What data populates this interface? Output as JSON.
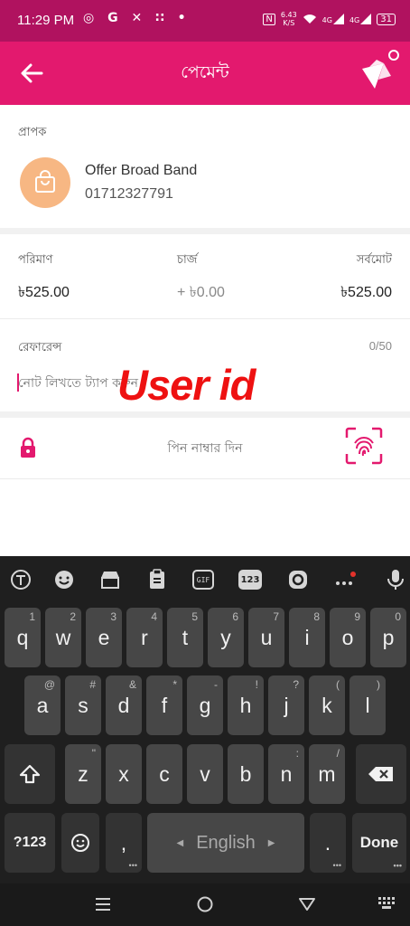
{
  "status_bar": {
    "time": "11:29 PM",
    "notif_icons": "◎ G ✕ ∷ •",
    "net_speed_value": "6.43",
    "net_speed_unit": "K/S",
    "signal1": "4G",
    "signal2": "4G",
    "battery": "31",
    "nfc": "N"
  },
  "app_bar": {
    "title": "পেমেন্ট",
    "back_icon": "arrow-left-icon",
    "logo_icon": "bkash-bird-logo"
  },
  "recipient": {
    "label": "প্রাপক",
    "name": "Offer Broad Band",
    "number": "01712327791",
    "icon": "shopping-bag-icon"
  },
  "amounts": {
    "amount_label": "পরিমাণ",
    "amount_value": "৳525.00",
    "charge_label": "চার্জ",
    "charge_value": "+ ৳0.00",
    "total_label": "সর্বমোট",
    "total_value": "৳525.00"
  },
  "reference": {
    "label": "রেফারেন্স",
    "counter": "0/50",
    "placeholder": "নোট লিখতে ট্যাপ করুন",
    "overlay_annotation": "User id"
  },
  "pin": {
    "placeholder": "পিন নাম্বার দিন",
    "lock_icon": "lock-icon",
    "fingerprint_icon": "fingerprint-icon"
  },
  "keyboard": {
    "toolbar": [
      "translate-icon",
      "emoji-icon",
      "store-icon",
      "clipboard-icon",
      "gif-icon",
      "numpad-icon",
      "sticker-icon",
      "more-icon",
      "mic-icon"
    ],
    "numpad_label": "123",
    "gif_label": "GIF",
    "row1": [
      {
        "k": "q",
        "h": "1"
      },
      {
        "k": "w",
        "h": "2"
      },
      {
        "k": "e",
        "h": "3"
      },
      {
        "k": "r",
        "h": "4"
      },
      {
        "k": "t",
        "h": "5"
      },
      {
        "k": "y",
        "h": "6"
      },
      {
        "k": "u",
        "h": "7"
      },
      {
        "k": "i",
        "h": "8"
      },
      {
        "k": "o",
        "h": "9"
      },
      {
        "k": "p",
        "h": "0"
      }
    ],
    "row2": [
      {
        "k": "a",
        "h": "@"
      },
      {
        "k": "s",
        "h": "#"
      },
      {
        "k": "d",
        "h": "&"
      },
      {
        "k": "f",
        "h": "*"
      },
      {
        "k": "g",
        "h": "-"
      },
      {
        "k": "h",
        "h": "!"
      },
      {
        "k": "j",
        "h": "?"
      },
      {
        "k": "k",
        "h": "("
      },
      {
        "k": "l",
        "h": ")"
      }
    ],
    "row3": [
      {
        "k": "z",
        "h": "\""
      },
      {
        "k": "x",
        "h": ""
      },
      {
        "k": "c",
        "h": ""
      },
      {
        "k": "v",
        "h": ""
      },
      {
        "k": "b",
        "h": ""
      },
      {
        "k": "n",
        "h": ":"
      },
      {
        "k": "m",
        "h": "/"
      }
    ],
    "sym_label": "?123",
    "comma": ",",
    "space_label": "English",
    "period": ".",
    "done_label": "Done"
  },
  "nav_bar": [
    "recents-icon",
    "home-icon",
    "back-triangle-icon",
    "keyboard-switch-icon"
  ],
  "colors": {
    "status_bar": "#b0125f",
    "app_bar": "#e3196e",
    "accent": "#e3196e",
    "avatar": "#f7b783",
    "overlay_text": "#ee1111",
    "keyboard_bg": "#1f1f1f",
    "key_bg": "#474747"
  }
}
